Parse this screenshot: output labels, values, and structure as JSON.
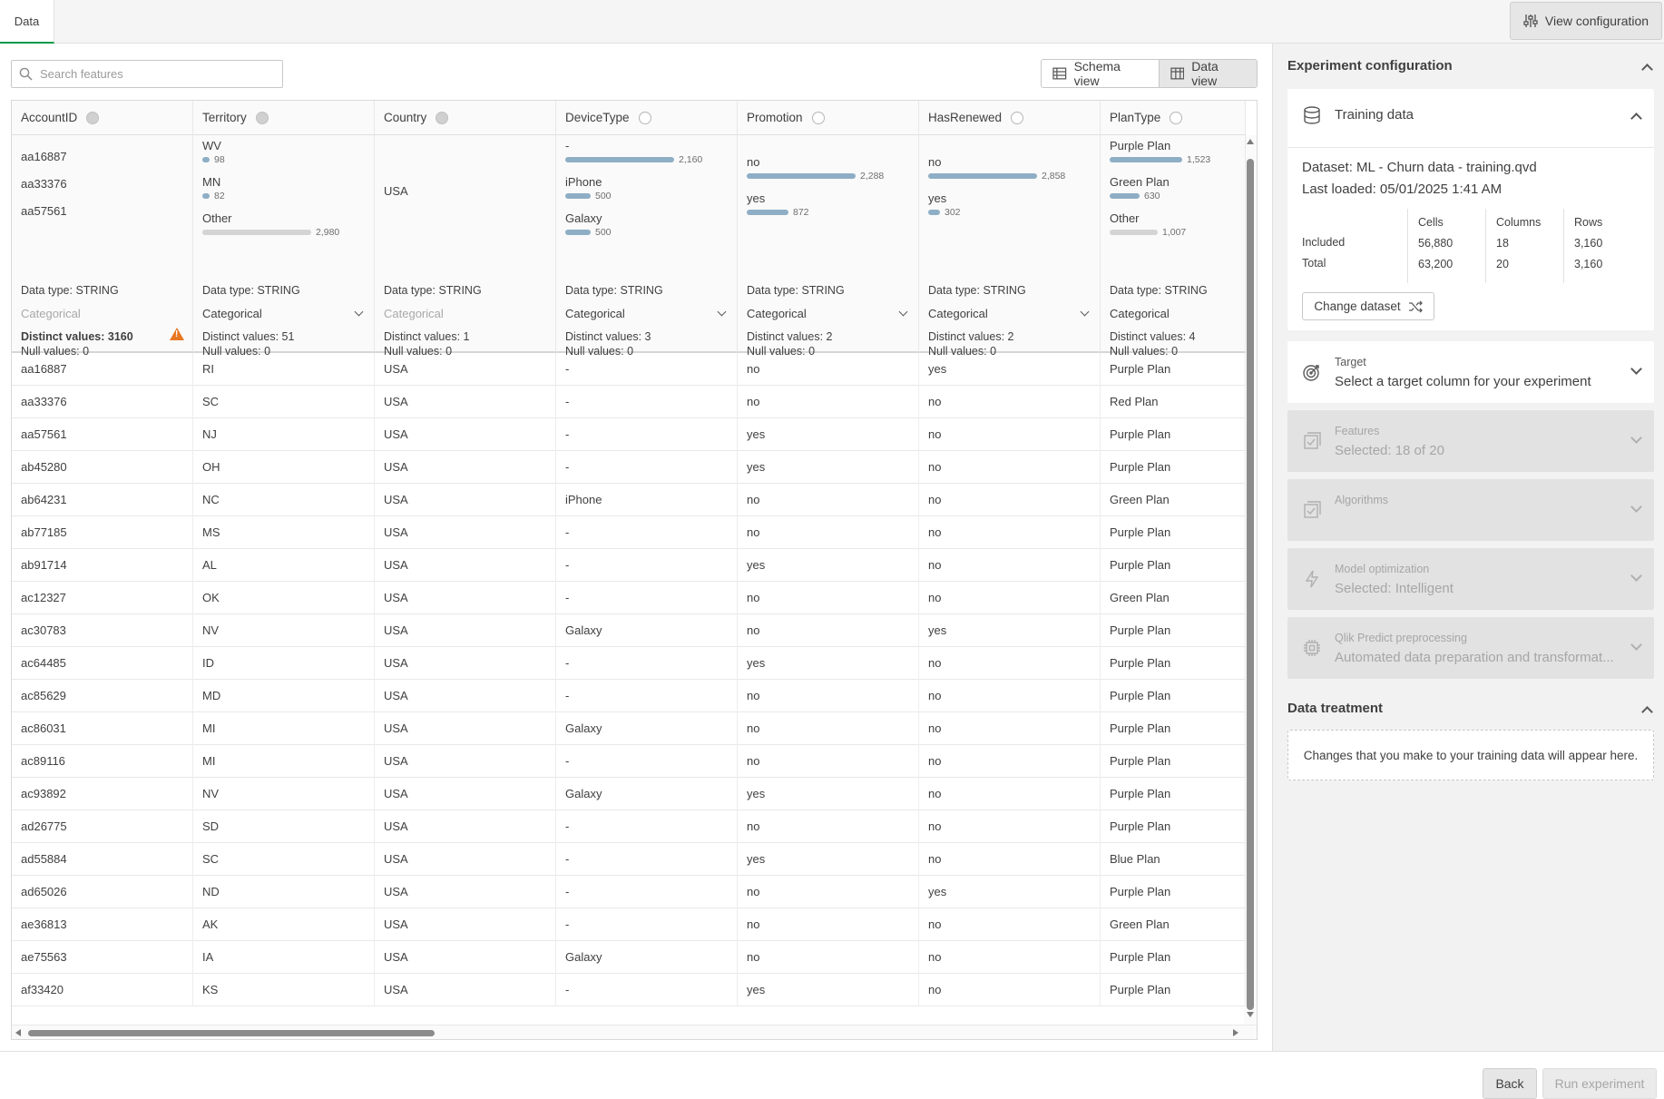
{
  "tabs": {
    "data": "Data"
  },
  "header": {
    "view_configuration": "View configuration"
  },
  "search": {
    "placeholder": "Search features"
  },
  "view_toggle": {
    "schema": "Schema view",
    "data": "Data view",
    "active": "data"
  },
  "columns": [
    {
      "name": "AccountID",
      "indicator": "filled",
      "top_values": [
        {
          "label": "aa16887"
        },
        {
          "label": "aa33376"
        },
        {
          "label": "aa57561"
        }
      ],
      "data_type": "Data type: STRING",
      "feature_type": "Categorical",
      "feature_type_enabled": false,
      "distinct": "Distinct values: 3160",
      "nulls": "Null values: 0",
      "warning": true
    },
    {
      "name": "Territory",
      "indicator": "filled",
      "top_values": [
        {
          "label": "WV",
          "count": "98",
          "frac": 0.033
        },
        {
          "label": "MN",
          "count": "82",
          "frac": 0.028
        },
        {
          "label": "Other",
          "count": "2,980",
          "frac": 1.0,
          "grey": true
        }
      ],
      "data_type": "Data type: STRING",
      "feature_type": "Categorical",
      "feature_type_enabled": true,
      "distinct": "Distinct values: 51",
      "nulls": "Null values: 0"
    },
    {
      "name": "Country",
      "indicator": "filled",
      "top_values": [
        {
          "label": "USA"
        }
      ],
      "data_type": "Data type: STRING",
      "feature_type": "Categorical",
      "feature_type_enabled": false,
      "distinct": "Distinct values: 1",
      "nulls": "Null values: 0"
    },
    {
      "name": "DeviceType",
      "indicator": "empty",
      "top_values": [
        {
          "label": "-",
          "count": "2,160",
          "frac": 1.0
        },
        {
          "label": "iPhone",
          "count": "500",
          "frac": 0.231
        },
        {
          "label": "Galaxy",
          "count": "500",
          "frac": 0.231
        }
      ],
      "data_type": "Data type: STRING",
      "feature_type": "Categorical",
      "feature_type_enabled": true,
      "distinct": "Distinct values: 3",
      "nulls": "Null values: 0"
    },
    {
      "name": "Promotion",
      "indicator": "empty",
      "top_values": [
        {
          "label": "no",
          "count": "2,288",
          "frac": 1.0
        },
        {
          "label": "yes",
          "count": "872",
          "frac": 0.381
        }
      ],
      "data_type": "Data type: STRING",
      "feature_type": "Categorical",
      "feature_type_enabled": true,
      "distinct": "Distinct values: 2",
      "nulls": "Null values: 0"
    },
    {
      "name": "HasRenewed",
      "indicator": "empty",
      "top_values": [
        {
          "label": "no",
          "count": "2,858",
          "frac": 1.0
        },
        {
          "label": "yes",
          "count": "302",
          "frac": 0.106
        }
      ],
      "data_type": "Data type: STRING",
      "feature_type": "Categorical",
      "feature_type_enabled": true,
      "distinct": "Distinct values: 2",
      "nulls": "Null values: 0"
    },
    {
      "name": "PlanType",
      "indicator": "empty",
      "top_values": [
        {
          "label": "Purple Plan",
          "count": "1,523",
          "frac": 1.0
        },
        {
          "label": "Green Plan",
          "count": "630",
          "frac": 0.414
        },
        {
          "label": "Other",
          "count": "1,007",
          "frac": 0.661,
          "grey": true
        }
      ],
      "data_type": "Data type: STRING",
      "feature_type": "Categorical",
      "feature_type_enabled": true,
      "distinct": "Distinct values: 4",
      "nulls": "Null values: 0"
    }
  ],
  "rows": [
    [
      "aa16887",
      "RI",
      "USA",
      "-",
      "no",
      "yes",
      "Purple Plan"
    ],
    [
      "aa33376",
      "SC",
      "USA",
      "-",
      "no",
      "no",
      "Red Plan"
    ],
    [
      "aa57561",
      "NJ",
      "USA",
      "-",
      "yes",
      "no",
      "Purple Plan"
    ],
    [
      "ab45280",
      "OH",
      "USA",
      "-",
      "yes",
      "no",
      "Purple Plan"
    ],
    [
      "ab64231",
      "NC",
      "USA",
      "iPhone",
      "no",
      "no",
      "Green Plan"
    ],
    [
      "ab77185",
      "MS",
      "USA",
      "-",
      "no",
      "no",
      "Purple Plan"
    ],
    [
      "ab91714",
      "AL",
      "USA",
      "-",
      "yes",
      "no",
      "Purple Plan"
    ],
    [
      "ac12327",
      "OK",
      "USA",
      "-",
      "no",
      "no",
      "Green Plan"
    ],
    [
      "ac30783",
      "NV",
      "USA",
      "Galaxy",
      "no",
      "yes",
      "Purple Plan"
    ],
    [
      "ac64485",
      "ID",
      "USA",
      "-",
      "yes",
      "no",
      "Purple Plan"
    ],
    [
      "ac85629",
      "MD",
      "USA",
      "-",
      "no",
      "no",
      "Purple Plan"
    ],
    [
      "ac86031",
      "MI",
      "USA",
      "Galaxy",
      "no",
      "no",
      "Purple Plan"
    ],
    [
      "ac89116",
      "MI",
      "USA",
      "-",
      "no",
      "no",
      "Purple Plan"
    ],
    [
      "ac93892",
      "NV",
      "USA",
      "Galaxy",
      "yes",
      "no",
      "Purple Plan"
    ],
    [
      "ad26775",
      "SD",
      "USA",
      "-",
      "no",
      "no",
      "Purple Plan"
    ],
    [
      "ad55884",
      "SC",
      "USA",
      "-",
      "yes",
      "no",
      "Blue Plan"
    ],
    [
      "ad65026",
      "ND",
      "USA",
      "-",
      "no",
      "yes",
      "Purple Plan"
    ],
    [
      "ae36813",
      "AK",
      "USA",
      "-",
      "no",
      "no",
      "Green Plan"
    ],
    [
      "ae75563",
      "IA",
      "USA",
      "Galaxy",
      "no",
      "no",
      "Purple Plan"
    ],
    [
      "af33420",
      "KS",
      "USA",
      "-",
      "yes",
      "no",
      "Purple Plan"
    ]
  ],
  "config": {
    "title": "Experiment configuration",
    "training": {
      "title": "Training data",
      "dataset": "Dataset: ML - Churn data - training.qvd",
      "last_loaded": "Last loaded: 05/01/2025 1:41 AM",
      "headers": [
        "Cells",
        "Columns",
        "Rows"
      ],
      "included": {
        "label": "Included",
        "cells": "56,880",
        "columns": "18",
        "rows": "3,160"
      },
      "total": {
        "label": "Total",
        "cells": "63,200",
        "columns": "20",
        "rows": "3,160"
      },
      "change_button": "Change dataset"
    },
    "target": {
      "title": "Target",
      "subtitle": "Select a target column for your experiment"
    },
    "features": {
      "title": "Features",
      "subtitle": "Selected: 18 of 20"
    },
    "algorithms": {
      "title": "Algorithms",
      "subtitle": ""
    },
    "optimization": {
      "title": "Model optimization",
      "subtitle": "Selected: Intelligent"
    },
    "preprocessing": {
      "title": "Qlik Predict preprocessing",
      "subtitle": "Automated data preparation and transformat..."
    },
    "treatment": {
      "title": "Data treatment",
      "text": "Changes that you make to your training data will appear here."
    }
  },
  "footer": {
    "back": "Back",
    "run": "Run experiment"
  }
}
